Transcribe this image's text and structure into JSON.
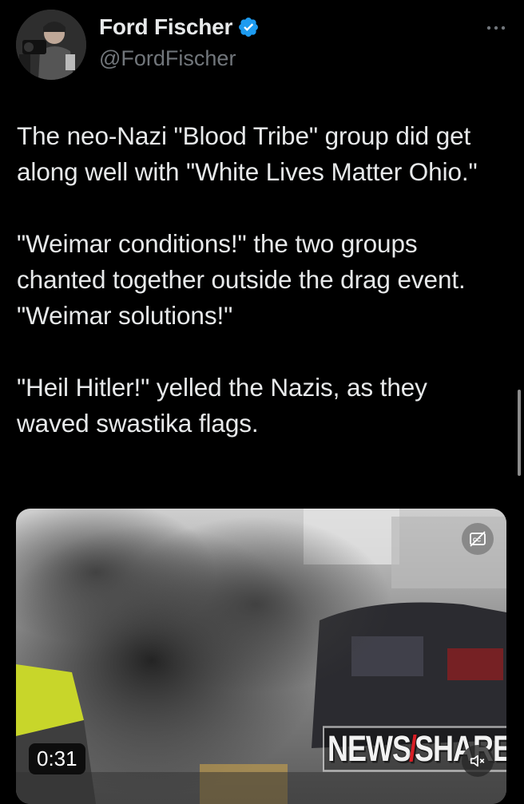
{
  "author": {
    "display_name": "Ford Fischer",
    "handle": "@FordFischer",
    "verified": true,
    "avatar_icon": "avatar-photo"
  },
  "menu": {
    "icon": "more-horizontal-icon"
  },
  "tweet": {
    "paragraphs": [
      "The neo-Nazi \"Blood Tribe\" group did get along well with \"White Lives Matter Ohio.\"",
      "\"Weimar conditions!\" the two groups chanted together outside the drag event. \"Weimar solutions!\"",
      "\"Heil Hitler!\" yelled the Nazis, as they waved swastika flags."
    ]
  },
  "media": {
    "duration": "0:31",
    "watermark_left": "NEWS",
    "watermark_slash": "/",
    "watermark_right": "SHARE",
    "captions_icon": "captions-off-icon",
    "mute_icon": "muted-speaker-icon"
  },
  "colors": {
    "background": "#000000",
    "text_primary": "#e7e9ea",
    "text_secondary": "#71767b",
    "verified_blue": "#1d9bf0"
  }
}
